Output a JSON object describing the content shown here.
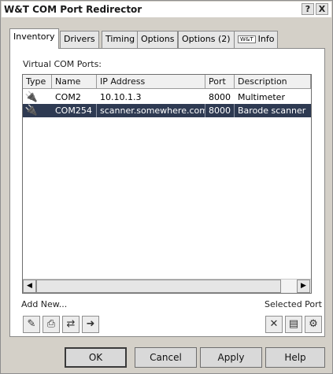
{
  "window": {
    "title": "W&T COM Port Redirector",
    "help_button": "?",
    "close_button": "X"
  },
  "tabs": [
    {
      "label": "Inventory",
      "active": true
    },
    {
      "label": "Drivers",
      "active": false
    },
    {
      "label": "Timing",
      "active": false
    },
    {
      "label": "Options",
      "active": false
    },
    {
      "label": "Options (2)",
      "active": false
    },
    {
      "label": "Info",
      "badge": "W&T",
      "active": false
    }
  ],
  "inventory": {
    "section_label": "Virtual COM Ports:",
    "columns": [
      "Type",
      "Name",
      "IP Address",
      "Port",
      "Description"
    ],
    "rows": [
      {
        "type_icon": "serial-plug-icon",
        "name": "COM2",
        "ip": "10.10.1.3",
        "port": "8000",
        "description": "Multimeter",
        "selected": false
      },
      {
        "type_icon": "serial-plug-icon",
        "name": "COM254",
        "ip": "scanner.somewhere.com",
        "port": "8000",
        "description": "Barode scanner",
        "selected": true
      }
    ],
    "add_new_label": "Add New...",
    "selected_port_label": "Selected Port",
    "add_buttons": [
      "add-serial-port-icon",
      "add-printer-icon",
      "add-network-device-icon",
      "add-redirect-icon"
    ],
    "selected_buttons": [
      "delete-icon",
      "properties-icon",
      "port-settings-icon"
    ]
  },
  "footer": {
    "ok": "OK",
    "cancel": "Cancel",
    "apply": "Apply",
    "help": "Help"
  }
}
